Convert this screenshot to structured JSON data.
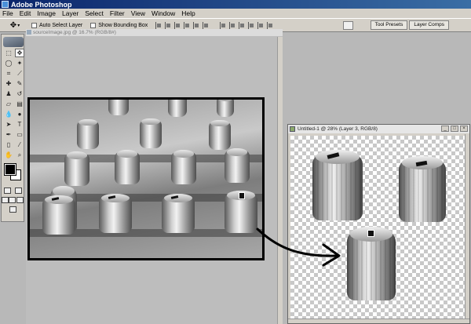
{
  "app": {
    "title": "Adobe Photoshop"
  },
  "menu": [
    "File",
    "Edit",
    "Image",
    "Layer",
    "Select",
    "Filter",
    "View",
    "Window",
    "Help"
  ],
  "options": {
    "auto_select_label": "Auto Select Layer",
    "show_bounding_label": "Show Bounding Box",
    "tabs": [
      "Tool Presets",
      "Layer Comps"
    ]
  },
  "source_doc": {
    "title": "sourceImage.jpg @ 16.7% (RGB/8#)"
  },
  "dest_doc": {
    "title": "Untitled-1 @ 28% (Layer 3, RGB/8)",
    "buttons": [
      "_",
      "□",
      "×"
    ]
  },
  "colors": {
    "foreground": "#000000",
    "background": "#ffffff",
    "titlebar": "#0a246a"
  },
  "icons": {
    "app": "photoshop-icon",
    "move_tool": "move-icon",
    "arrow_annotation": "curved-arrow-icon"
  }
}
